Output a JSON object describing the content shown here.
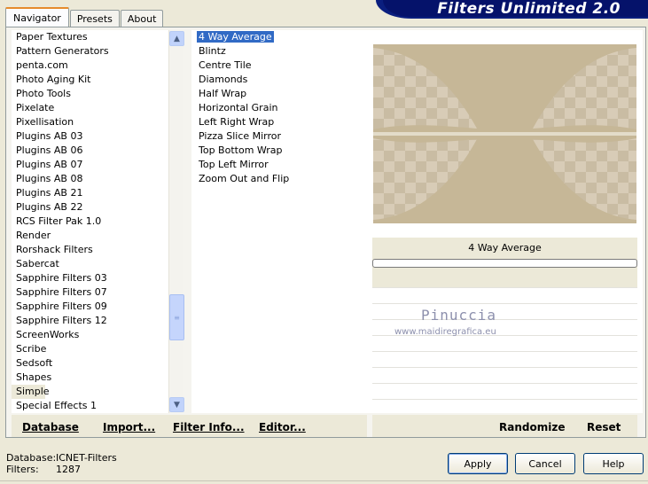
{
  "tabs": [
    {
      "label": "Navigator",
      "active": true
    },
    {
      "label": "Presets",
      "active": false
    },
    {
      "label": "About",
      "active": false
    }
  ],
  "banner": {
    "title": "Filters Unlimited 2.0"
  },
  "categories": [
    {
      "label": "Paper Textures"
    },
    {
      "label": "Pattern Generators"
    },
    {
      "label": "penta.com"
    },
    {
      "label": "Photo Aging Kit"
    },
    {
      "label": "Photo Tools"
    },
    {
      "label": "Pixelate"
    },
    {
      "label": "Pixellisation"
    },
    {
      "label": "Plugins AB 03"
    },
    {
      "label": "Plugins AB 06"
    },
    {
      "label": "Plugins AB 07"
    },
    {
      "label": "Plugins AB 08"
    },
    {
      "label": "Plugins AB 21"
    },
    {
      "label": "Plugins AB 22"
    },
    {
      "label": "RCS Filter Pak 1.0"
    },
    {
      "label": "Render"
    },
    {
      "label": "Rorshack Filters"
    },
    {
      "label": "Sabercat"
    },
    {
      "label": "Sapphire Filters 03"
    },
    {
      "label": "Sapphire Filters 07"
    },
    {
      "label": "Sapphire Filters 09"
    },
    {
      "label": "Sapphire Filters 12"
    },
    {
      "label": "ScreenWorks"
    },
    {
      "label": "Scribe"
    },
    {
      "label": "Sedsoft"
    },
    {
      "label": "Shapes"
    },
    {
      "label": "Simple",
      "selected": true
    },
    {
      "label": "Special Effects 1"
    }
  ],
  "filters": [
    {
      "label": "4 Way Average",
      "selected": true
    },
    {
      "label": "Blintz"
    },
    {
      "label": "Centre Tile"
    },
    {
      "label": "Diamonds"
    },
    {
      "label": "Half Wrap"
    },
    {
      "label": "Horizontal Grain"
    },
    {
      "label": "Left Right Wrap"
    },
    {
      "label": "Pizza Slice Mirror"
    },
    {
      "label": "Top Bottom Wrap"
    },
    {
      "label": "Top Left Mirror"
    },
    {
      "label": "Zoom Out and Flip"
    }
  ],
  "preview": {
    "filter_name": "4 Way Average"
  },
  "watermark": {
    "name": "Pinuccia",
    "url": "www.maidiregrafica.eu"
  },
  "toolbar": {
    "database": "Database",
    "import": "Import...",
    "filter_info": "Filter Info...",
    "editor": "Editor...",
    "randomize": "Randomize",
    "reset": "Reset"
  },
  "footer": {
    "database_label": "Database:",
    "database_value": "ICNET-Filters",
    "filters_label": "Filters:",
    "filters_value": "1287"
  },
  "buttons": {
    "apply": "Apply",
    "cancel": "Cancel",
    "help": "Help"
  },
  "colors": {
    "selection": "#316ac5",
    "banner": "#05126a",
    "preview_tan": "#c6b797"
  }
}
